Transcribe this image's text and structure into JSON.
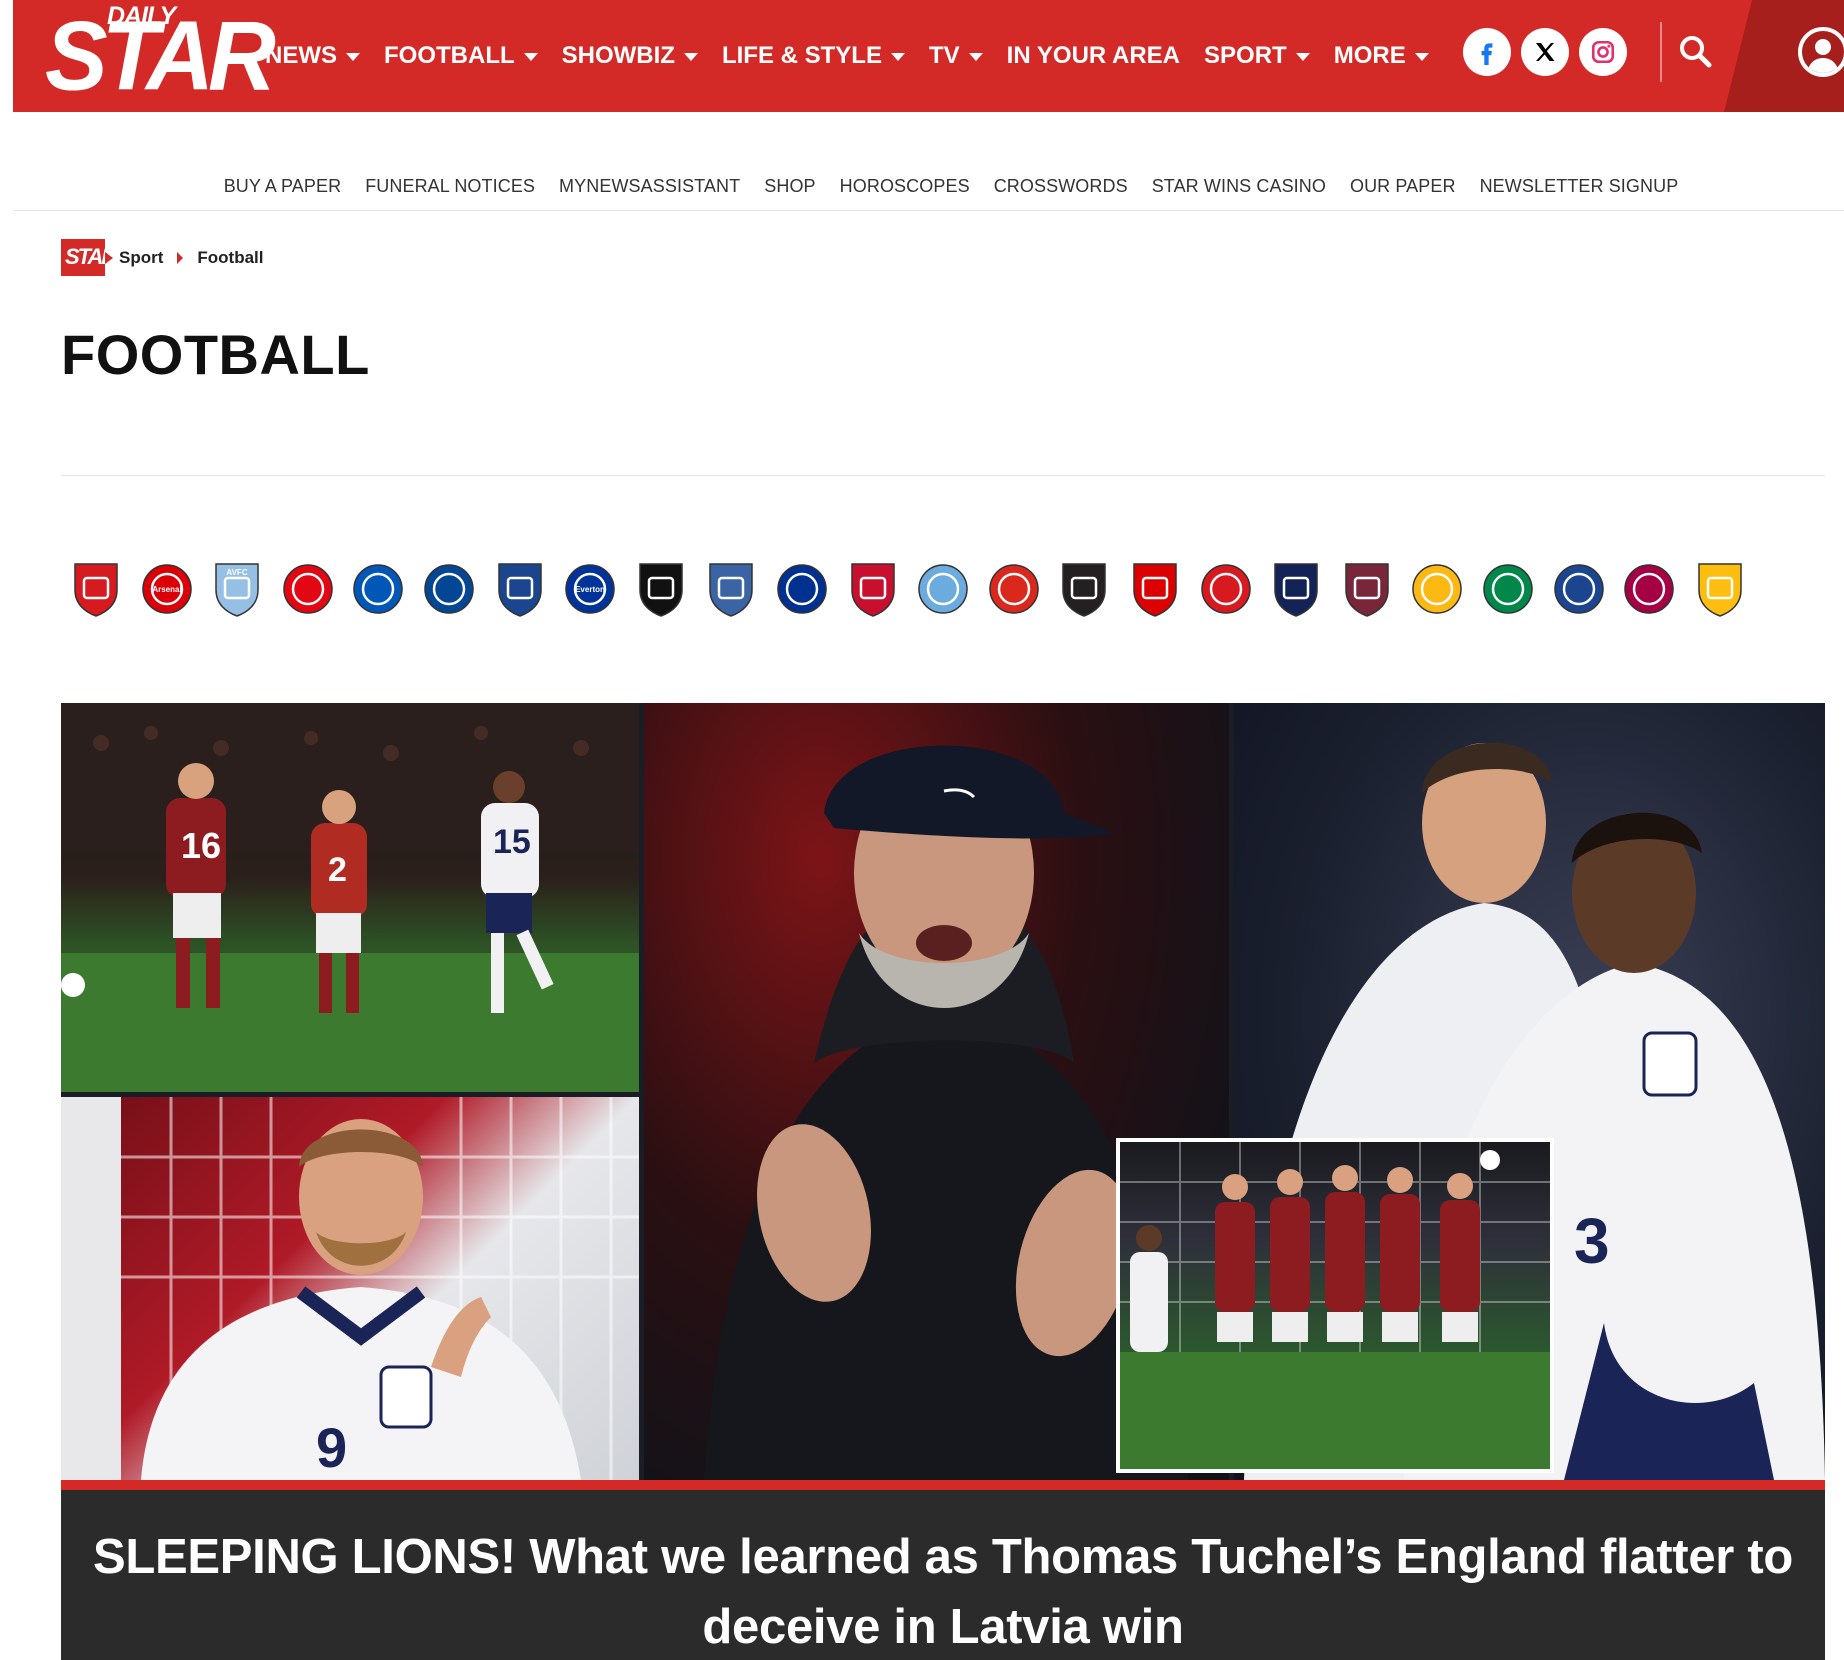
{
  "header": {
    "logo_top": "DAILY",
    "logo_main": "STAR",
    "nav": [
      {
        "label": "NEWS",
        "dropdown": true
      },
      {
        "label": "FOOTBALL",
        "dropdown": true
      },
      {
        "label": "SHOWBIZ",
        "dropdown": true
      },
      {
        "label": "LIFE & STYLE",
        "dropdown": true
      },
      {
        "label": "TV",
        "dropdown": true
      },
      {
        "label": "IN YOUR AREA",
        "dropdown": false
      },
      {
        "label": "SPORT",
        "dropdown": true
      },
      {
        "label": "MORE",
        "dropdown": true
      }
    ],
    "social_icons": [
      "facebook-icon",
      "x-icon",
      "instagram-icon"
    ],
    "search_icon": "search-icon",
    "account_icon": "account-icon",
    "brand_color": "#d42a27"
  },
  "subnav": [
    "BUY A PAPER",
    "FUNERAL NOTICES",
    "MYNEWSASSISTANT",
    "SHOP",
    "HOROSCOPES",
    "CROSSWORDS",
    "STAR WINS CASINO",
    "OUR PAPER",
    "NEWSLETTER SIGNUP"
  ],
  "breadcrumb": {
    "logo": "STAR",
    "items": [
      "Sport",
      "Football"
    ]
  },
  "page_title": "FOOTBALL",
  "crests": [
    {
      "name": "bournemouth-crest-icon",
      "color": "#d71920",
      "text": ""
    },
    {
      "name": "arsenal-crest-icon",
      "color": "#db0007",
      "text": "Arsenal"
    },
    {
      "name": "aston-villa-crest-icon",
      "color": "#95bfe5",
      "text": "AVFC"
    },
    {
      "name": "brentford-crest-icon",
      "color": "#e30613",
      "text": ""
    },
    {
      "name": "brighton-crest-icon",
      "color": "#0057b8",
      "text": ""
    },
    {
      "name": "chelsea-crest-icon",
      "color": "#034694",
      "text": ""
    },
    {
      "name": "crystal-palace-crest-icon",
      "color": "#1b458f",
      "text": ""
    },
    {
      "name": "everton-crest-icon",
      "color": "#003399",
      "text": "Everton"
    },
    {
      "name": "fulham-crest-icon",
      "color": "#111111",
      "text": ""
    },
    {
      "name": "ipswich-crest-icon",
      "color": "#3a64a3",
      "text": ""
    },
    {
      "name": "leicester-crest-icon",
      "color": "#003090",
      "text": ""
    },
    {
      "name": "liverpool-crest-icon",
      "color": "#c8102e",
      "text": ""
    },
    {
      "name": "manchester-city-crest-icon",
      "color": "#6cabdd",
      "text": ""
    },
    {
      "name": "manchester-united-crest-icon",
      "color": "#da291c",
      "text": ""
    },
    {
      "name": "newcastle-crest-icon",
      "color": "#241f20",
      "text": ""
    },
    {
      "name": "nottingham-forest-crest-icon",
      "color": "#dd0000",
      "text": ""
    },
    {
      "name": "southampton-crest-icon",
      "color": "#d71920",
      "text": ""
    },
    {
      "name": "tottenham-crest-icon",
      "color": "#132257",
      "text": ""
    },
    {
      "name": "west-ham-crest-icon",
      "color": "#7a263a",
      "text": ""
    },
    {
      "name": "wolves-crest-icon",
      "color": "#fdb913",
      "text": ""
    },
    {
      "name": "celtic-crest-icon",
      "color": "#018749",
      "text": ""
    },
    {
      "name": "rangers-crest-icon",
      "color": "#1b458f",
      "text": ""
    },
    {
      "name": "barcelona-crest-icon",
      "color": "#a50044",
      "text": ""
    },
    {
      "name": "real-madrid-crest-icon",
      "color": "#febe10",
      "text": ""
    }
  ],
  "hero": {
    "headline": "SLEEPING LIONS! What we learned as Thomas Tuchel’s England flatter to deceive in Latvia win",
    "image_alt": "england-latvia-collage-image"
  }
}
